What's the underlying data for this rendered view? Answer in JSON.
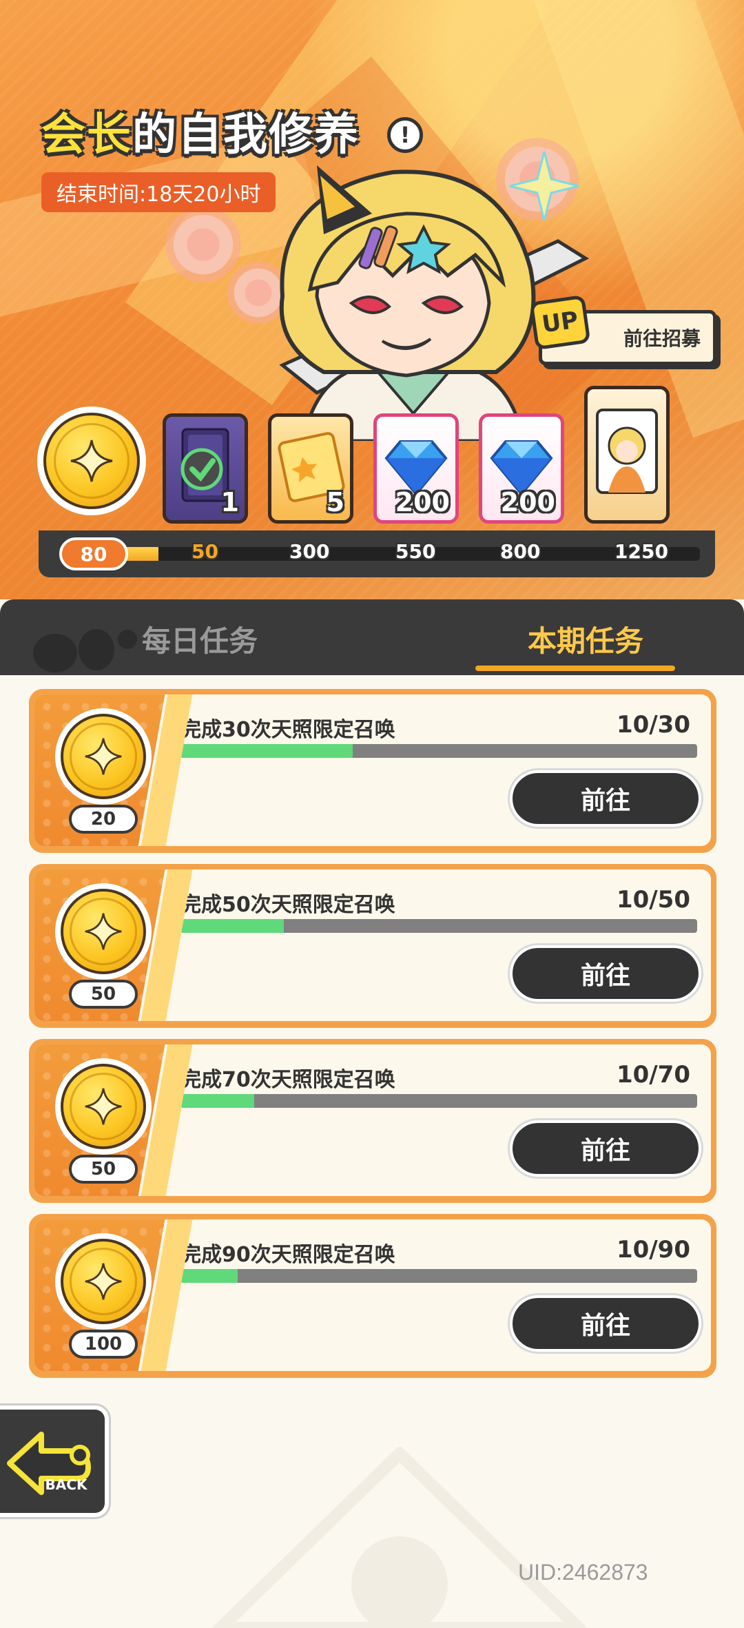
{
  "event": {
    "title_highlight": "会长",
    "title_rest": "的自我修养",
    "info_symbol": "!",
    "end_time": "结束时间:18天20小时"
  },
  "recruit": {
    "badge": "UP",
    "label": "前往招募"
  },
  "reward_track": {
    "current_points": "80",
    "progress_fraction": 0.064,
    "rewards": [
      {
        "type": "claimed-card",
        "quantity": "1",
        "claimed": true
      },
      {
        "type": "ticket",
        "quantity": "5",
        "claimed": false
      },
      {
        "type": "diamond",
        "quantity": "200",
        "claimed": false
      },
      {
        "type": "diamond",
        "quantity": "200",
        "claimed": false
      },
      {
        "type": "character-card",
        "quantity": "",
        "claimed": false
      }
    ],
    "milestones": [
      "50",
      "300",
      "550",
      "800",
      "1250"
    ]
  },
  "tabs": {
    "daily": "每日任务",
    "period": "本期任务",
    "active": "period"
  },
  "tasks": [
    {
      "title": "完成30次天照限定召唤",
      "progress": "10/30",
      "fraction": 0.333,
      "reward": "20",
      "button": "前往"
    },
    {
      "title": "完成50次天照限定召唤",
      "progress": "10/50",
      "fraction": 0.2,
      "reward": "50",
      "button": "前往"
    },
    {
      "title": "完成70次天照限定召唤",
      "progress": "10/70",
      "fraction": 0.143,
      "reward": "50",
      "button": "前往"
    },
    {
      "title": "完成90次天照限定召唤",
      "progress": "10/90",
      "fraction": 0.111,
      "reward": "100",
      "button": "前往"
    }
  ],
  "back_button": {
    "label": "BACK"
  },
  "uid": "UID:2462873",
  "colors": {
    "accent_orange": "#f28a35",
    "highlight_yellow": "#ffe23a",
    "progress_green": "#5fd97a",
    "dark": "#333333"
  }
}
